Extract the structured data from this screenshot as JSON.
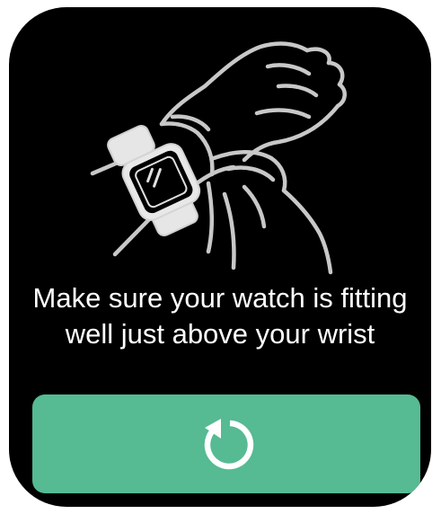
{
  "screen": {
    "background_color": "#000000",
    "illustration_icon": "hand-wearing-watch-illustration",
    "instruction": "Make sure your watch is fitting well just above your wrist"
  },
  "retry_button": {
    "icon": "refresh-icon",
    "color": "#56ba93"
  }
}
